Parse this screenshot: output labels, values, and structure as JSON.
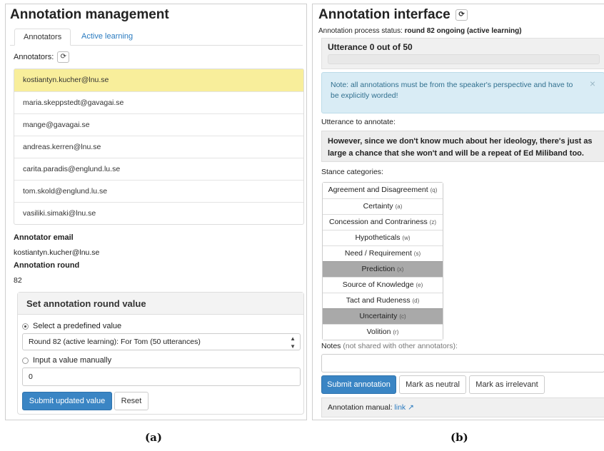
{
  "panel_a": {
    "title": "Annotation management",
    "tabs": [
      "Annotators",
      "Active learning"
    ],
    "annotators_label": "Annotators:",
    "annotators": [
      "kostiantyn.kucher@lnu.se",
      "maria.skeppstedt@gavagai.se",
      "mange@gavagai.se",
      "andreas.kerren@lnu.se",
      "carita.paradis@englund.lu.se",
      "tom.skold@englund.lu.se",
      "vasiliki.simaki@lnu.se"
    ],
    "selected_annotator": "kostiantyn.kucher@lnu.se",
    "annotator_email_label": "Annotator email",
    "annotator_email_value": "kostiantyn.kucher@lnu.se",
    "annotation_round_label": "Annotation round",
    "annotation_round_value": "82",
    "set_round": {
      "title": "Set annotation round value",
      "predefined_label": "Select a predefined value",
      "predefined_selected": "Round 82 (active learning): For Tom (50 utterances)",
      "manual_label": "Input a value manually",
      "manual_value": "0",
      "submit_label": "Submit updated value",
      "reset_label": "Reset"
    },
    "caption": "(a)"
  },
  "panel_b": {
    "title": "Annotation interface",
    "status_prefix": "Annotation process status:",
    "status_value": "round 82 ongoing (active learning)",
    "utterance_counter": "Utterance 0 out of 50",
    "progress": 0,
    "note": "Note: all annotations must be from the speaker's perspective and have to be explicitly worded!",
    "utterance_label": "Utterance to annotate:",
    "utterance_text": "However, since we don't know much about her ideology, there's just as large a chance that she won't and will be a repeat of Ed Miliband too.",
    "stance_label": "Stance categories:",
    "stance_categories": [
      {
        "label": "Agreement and Disagreement",
        "key": "(q)",
        "active": false
      },
      {
        "label": "Certainty",
        "key": "(a)",
        "active": false
      },
      {
        "label": "Concession and Contrariness",
        "key": "(z)",
        "active": false
      },
      {
        "label": "Hypotheticals",
        "key": "(w)",
        "active": false
      },
      {
        "label": "Need / Requirement",
        "key": "(s)",
        "active": false
      },
      {
        "label": "Prediction",
        "key": "(x)",
        "active": true
      },
      {
        "label": "Source of Knowledge",
        "key": "(e)",
        "active": false
      },
      {
        "label": "Tact and Rudeness",
        "key": "(d)",
        "active": false
      },
      {
        "label": "Uncertainty",
        "key": "(c)",
        "active": true
      },
      {
        "label": "Volition",
        "key": "(r)",
        "active": false
      }
    ],
    "notes_label": "Notes",
    "notes_hint": "(not shared with other annotators):",
    "notes_value": "",
    "submit_label": "Submit annotation",
    "neutral_label": "Mark as neutral",
    "irrelevant_label": "Mark as irrelevant",
    "manual_prefix": "Annotation manual:",
    "manual_link": "link",
    "caption": "(b)"
  },
  "colors": {
    "primary": "#3a85c4",
    "selected_row": "#f8ee9b",
    "active_category": "#a9a9a9",
    "note_bg": "#d9ecf5",
    "link": "#2a7bc0"
  },
  "icons": [
    "refresh-icon",
    "close-icon",
    "external-link-icon",
    "select-arrows-icon"
  ]
}
